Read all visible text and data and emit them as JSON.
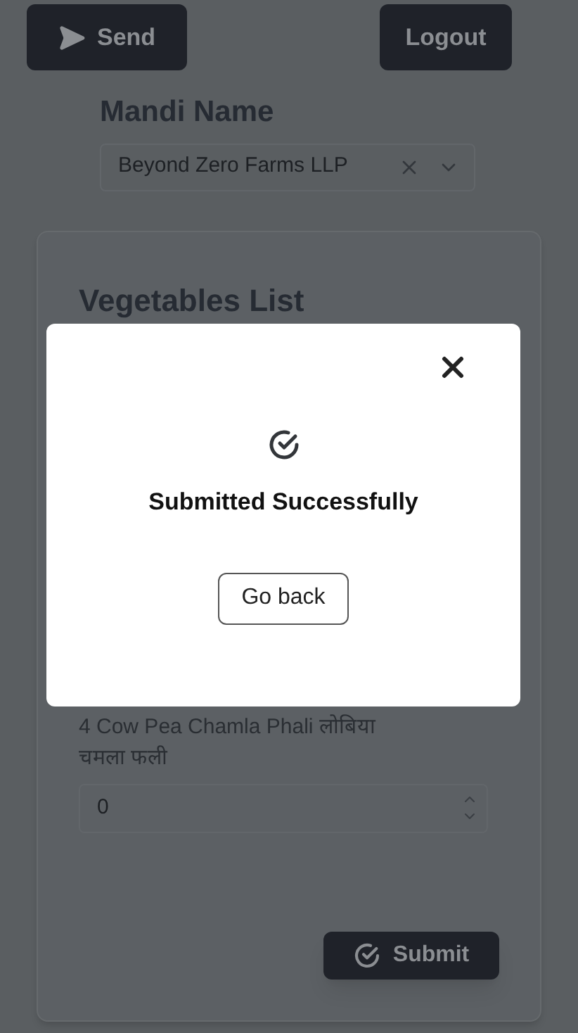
{
  "toolbar": {
    "send_button": "Send",
    "logout_button": "Logout"
  },
  "mandi": {
    "label": "Mandi Name",
    "value": "Beyond Zero Farms LLP"
  },
  "list": {
    "title": "Vegetables List",
    "items": [
      {
        "label": "4 Cow Pea Chamla Phali लोबिया चमला फली",
        "value": "0"
      }
    ],
    "submit_button": "Submit"
  },
  "dialog": {
    "title": "Submitted Successfully",
    "button": "Go back"
  }
}
